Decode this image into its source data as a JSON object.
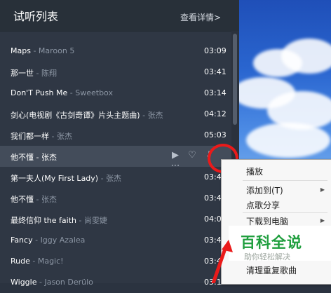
{
  "header": {
    "title": "试听列表",
    "details_label": "查看详情>"
  },
  "songs": [
    {
      "title": "Maps",
      "artist": "Maroon 5",
      "duration": "03:09"
    },
    {
      "title": "那一世",
      "artist": "陈翔",
      "duration": "03:41"
    },
    {
      "title": "Don'T Push Me",
      "artist": "Sweetbox",
      "duration": "03:14"
    },
    {
      "title": "剑心(电视剧《古剑奇谭》片头主题曲)",
      "artist": "张杰",
      "duration": "04:12"
    },
    {
      "title": "我们都一样",
      "artist": "张杰",
      "duration": "05:03"
    },
    {
      "title": "他不懂",
      "artist": "张杰",
      "duration": ""
    },
    {
      "title": "第一夫人(My First Lady)",
      "artist": "张杰",
      "duration": "03:4"
    },
    {
      "title": "他不懂",
      "artist": "张杰",
      "duration": "03:4"
    },
    {
      "title": "最终信仰 the faith",
      "artist": "尚雯婕",
      "duration": "04:0"
    },
    {
      "title": "Fancy",
      "artist": "Iggy Azalea",
      "duration": "03:4"
    },
    {
      "title": "Rude",
      "artist": "Magic!",
      "duration": "03:4"
    },
    {
      "title": "Wiggle",
      "artist": "Jason Derülo",
      "duration": "03:1"
    }
  ],
  "separator": " - ",
  "selected_row_icons": [
    "play-icon",
    "heart-icon",
    "download-icon",
    "more-icon"
  ],
  "context_menu": {
    "items": [
      "播放",
      "添加到(T)",
      "点歌分享",
      "下载到电脑",
      "清理重复歌曲"
    ]
  },
  "watermark": {
    "main": "百科全说",
    "sub": "助你轻松解决"
  },
  "colors": {
    "highlight": "#ea1a1a",
    "watermark_green": "#1e9e3d"
  }
}
